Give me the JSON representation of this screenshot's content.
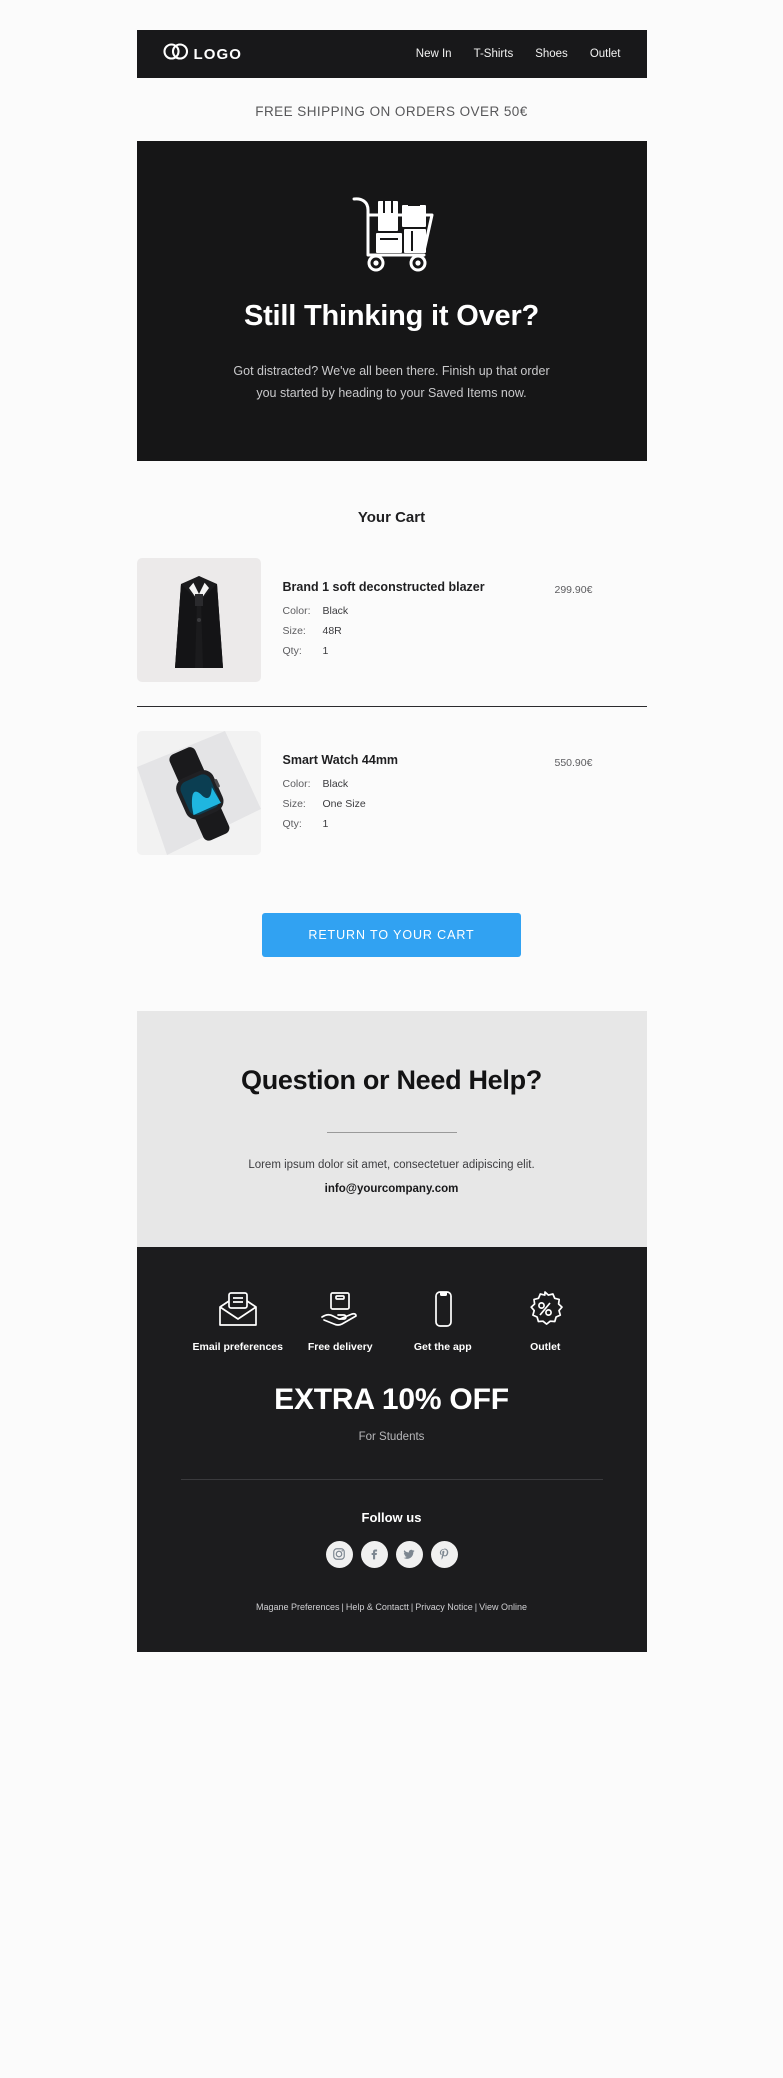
{
  "header": {
    "logo_text": "LOGO",
    "logo_icon": "two-overlapping-circles-icon",
    "nav": [
      {
        "label": "New In"
      },
      {
        "label": "T-Shirts"
      },
      {
        "label": "Shoes"
      },
      {
        "label": "Outlet"
      }
    ]
  },
  "shipping_bar": {
    "text": "FREE SHIPPING ON ORDERS OVER 50€"
  },
  "hero": {
    "icon": "shopping-trolley-with-boxes-icon",
    "title": "Still Thinking it Over?",
    "line1": "Got distracted? We've all been there. Finish up that order",
    "line2": "you started by heading to your Saved Items now."
  },
  "cart": {
    "title": "Your Cart",
    "labels": {
      "color": "Color:",
      "size": "Size:",
      "qty": "Qty:"
    },
    "items": [
      {
        "name": "Brand 1 soft deconstructed blazer",
        "price": "299.90€",
        "color": "Black",
        "size": "48R",
        "qty": "1",
        "image": "black-blazer-photo"
      },
      {
        "name": "Smart Watch 44mm",
        "price": "550.90€",
        "color": "Black",
        "size": "One Size",
        "qty": "1",
        "image": "smart-watch-photo"
      }
    ]
  },
  "cta": {
    "label": "RETURN TO YOUR CART",
    "color": "#31a2f2"
  },
  "help": {
    "title": "Question or Need Help?",
    "text": "Lorem ipsum dolor sit amet, consectetuer adipiscing elit.",
    "email": "info@yourcompany.com"
  },
  "footer": {
    "features": [
      {
        "label": "Email preferences",
        "icon": "open-envelope-icon"
      },
      {
        "label": "Free delivery",
        "icon": "hand-holding-box-icon"
      },
      {
        "label": "Get the app",
        "icon": "mobile-phone-icon"
      },
      {
        "label": "Outlet",
        "icon": "percent-badge-icon"
      }
    ],
    "promo_title": "EXTRA 10% OFF",
    "promo_sub": "For Students",
    "follow_label": "Follow us",
    "socials": [
      {
        "name": "instagram-icon"
      },
      {
        "name": "facebook-icon"
      },
      {
        "name": "twitter-icon"
      },
      {
        "name": "pinterest-icon"
      }
    ],
    "legal": [
      {
        "label": "Magane Preferences"
      },
      {
        "label": "Help & Contactt"
      },
      {
        "label": "Privacy Notice"
      },
      {
        "label": "View Online"
      }
    ],
    "legal_separator": "|"
  }
}
